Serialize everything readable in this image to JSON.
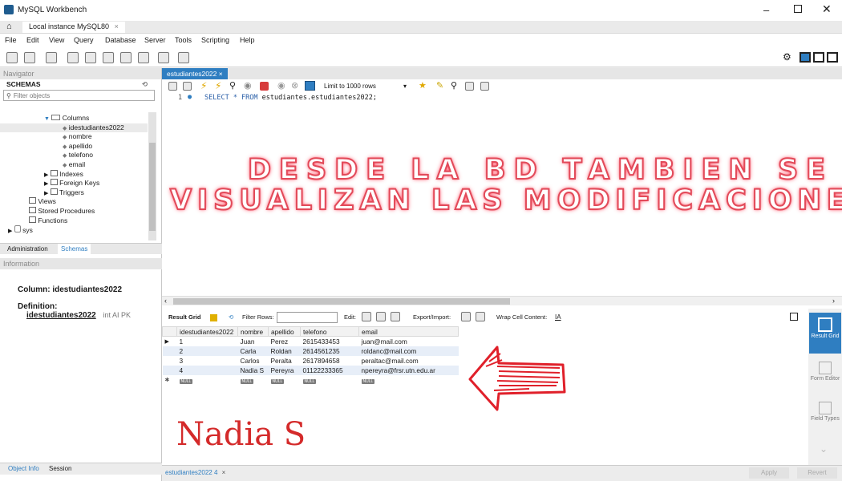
{
  "window": {
    "title": "MySQL Workbench"
  },
  "tab": {
    "label": "Local instance MySQL80",
    "close": "×"
  },
  "menu": [
    "File",
    "Edit",
    "View",
    "Query",
    "Database",
    "Server",
    "Tools",
    "Scripting",
    "Help"
  ],
  "navigator": {
    "header": "Navigator",
    "schemas_label": "SCHEMAS",
    "filter_placeholder": "Filter objects",
    "tree": [
      {
        "label": "Columns",
        "level": 3
      },
      {
        "label": "idestudiantes2022",
        "level": 4
      },
      {
        "label": "nombre",
        "level": 4
      },
      {
        "label": "apellido",
        "level": 4
      },
      {
        "label": "telefono",
        "level": 4
      },
      {
        "label": "email",
        "level": 4
      },
      {
        "label": "Indexes",
        "level": 3
      },
      {
        "label": "Foreign Keys",
        "level": 3
      },
      {
        "label": "Triggers",
        "level": 3
      },
      {
        "label": "Views",
        "level": 2
      },
      {
        "label": "Stored Procedures",
        "level": 2
      },
      {
        "label": "Functions",
        "level": 2
      },
      {
        "label": "sys",
        "level": 0
      }
    ],
    "tabs": [
      "Administration",
      "Schemas"
    ],
    "info_header": "Information",
    "info_column": "Column: idestudiantes2022",
    "info_definition_label": "Definition:",
    "info_def_name": "idestudiantes2022",
    "info_def_type": "int AI PK",
    "bottom_tabs": [
      "Object Info",
      "Session"
    ]
  },
  "editor": {
    "tab_label": "estudiantes2022",
    "limit_label": "Limit to 1000 rows",
    "line_number": "1",
    "sql_keyword": "SELECT * FROM",
    "sql_rest": " estudiantes.estudiantes2022;",
    "overlay_line1": "DESDE LA BD TAMBIEN SE",
    "overlay_line2": "VISUALIZAN LAS MODIFICACIONES",
    "handwriting": "Nadia S"
  },
  "result": {
    "toolbar": {
      "result_grid": "Result Grid",
      "filter_rows": "Filter Rows:",
      "edit": "Edit:",
      "export_import": "Export/Import:",
      "wrap_cell": "Wrap Cell Content:"
    },
    "columns": [
      "idestudiantes2022",
      "nombre",
      "apellido",
      "telefono",
      "email"
    ],
    "rows": [
      [
        "1",
        "Juan",
        "Perez",
        "2615433453",
        "juan@mail.com"
      ],
      [
        "2",
        "Carla",
        "Roldan",
        "2614561235",
        "roldanc@mail.com"
      ],
      [
        "3",
        "Carlos",
        "Peralta",
        "2617894658",
        "peraltac@mail.com"
      ],
      [
        "4",
        "Nadia S",
        "Pereyra",
        "01122233365",
        "npereyra@frsr.utn.edu.ar"
      ]
    ],
    "null_label": "NULL",
    "side_buttons": [
      "Result Grid",
      "Form Editor",
      "Field Types"
    ],
    "bottom_tab": "estudiantes2022 4",
    "apply": "Apply",
    "revert": "Revert"
  },
  "colors": {
    "accent": "#2f7ec1",
    "neon": "#e24a59",
    "handwriting": "#d42a2a"
  }
}
